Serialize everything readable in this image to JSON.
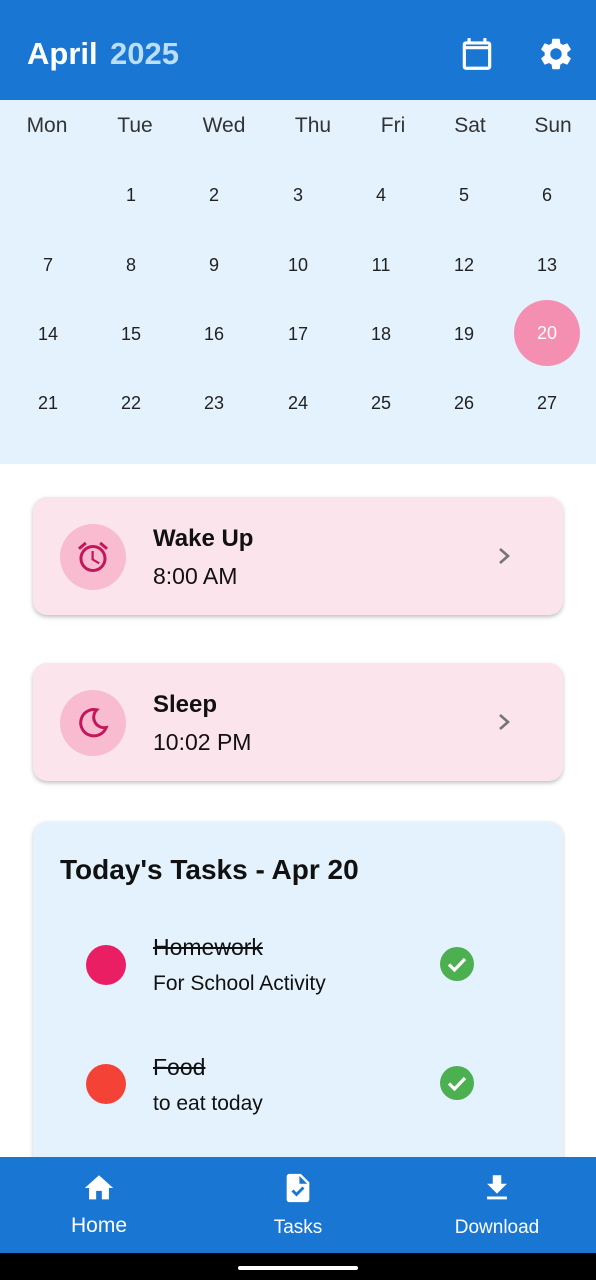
{
  "header": {
    "month": "April",
    "year": "2025",
    "calendar_icon": "calendar-icon",
    "settings_icon": "gear-icon",
    "bg_color": "#1976d2"
  },
  "calendar": {
    "weekdays": [
      "Mon",
      "Tue",
      "Wed",
      "Thu",
      "Fri",
      "Sat",
      "Sun"
    ],
    "weeks": [
      [
        "",
        "1",
        "2",
        "3",
        "4",
        "5",
        "6"
      ],
      [
        "7",
        "8",
        "9",
        "10",
        "11",
        "12",
        "13"
      ],
      [
        "14",
        "15",
        "16",
        "17",
        "18",
        "19",
        "20"
      ],
      [
        "21",
        "22",
        "23",
        "24",
        "25",
        "26",
        "27"
      ]
    ],
    "selected_day": "20",
    "selected_color": "#f48fb1"
  },
  "wake": {
    "title": "Wake Up",
    "time": "8:00 AM",
    "icon": "alarm-clock-icon"
  },
  "sleep": {
    "title": "Sleep",
    "time": "10:02 PM",
    "icon": "moon-icon"
  },
  "tasks": {
    "title": "Today's Tasks - Apr 20",
    "items": [
      {
        "name": "Homework",
        "desc": "For School Activity",
        "color": "#e91e63",
        "done": true
      },
      {
        "name": "Food",
        "desc": "to eat today",
        "color": "#f44336",
        "done": true
      }
    ]
  },
  "nav": {
    "home": "Home",
    "tasks": "Tasks",
    "download": "Download"
  }
}
